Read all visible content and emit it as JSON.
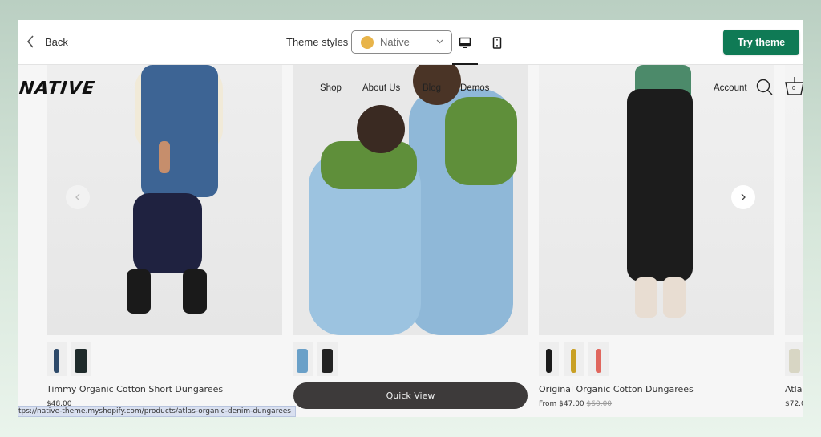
{
  "topbar": {
    "back_label": "Back",
    "theme_styles_label": "Theme styles",
    "theme_select": {
      "value": "Native",
      "swatch_color": "#e8b44a"
    },
    "device_options": [
      "desktop",
      "mobile"
    ],
    "active_device": "desktop",
    "try_theme_label": "Try theme",
    "accent_color": "#0f7a55"
  },
  "store": {
    "logo": "NATIVE",
    "nav": [
      "Shop",
      "About Us",
      "Blog",
      "Demos"
    ],
    "account_label": "Account",
    "cart_count": "0"
  },
  "products": [
    {
      "title": "Timmy Organic Cotton Short Dungarees",
      "price": "$48.00",
      "compare_price": "",
      "thumbs": 2
    },
    {
      "title": "",
      "price": "",
      "compare_price": "",
      "thumbs": 2,
      "quick_view_label": "Quick View"
    },
    {
      "title": "Original Organic Cotton Dungarees",
      "price": "From $47.00",
      "compare_price": "$60.00",
      "thumbs": 3
    },
    {
      "title": "Atlas",
      "price": "$72.0",
      "compare_price": "",
      "thumbs": 1
    }
  ],
  "carousel": {
    "prev_icon": "chevron-left-icon",
    "next_icon": "chevron-right-icon"
  },
  "status_bar_url": "tps://native-theme.myshopify.com/products/atlas-organic-denim-dungarees"
}
